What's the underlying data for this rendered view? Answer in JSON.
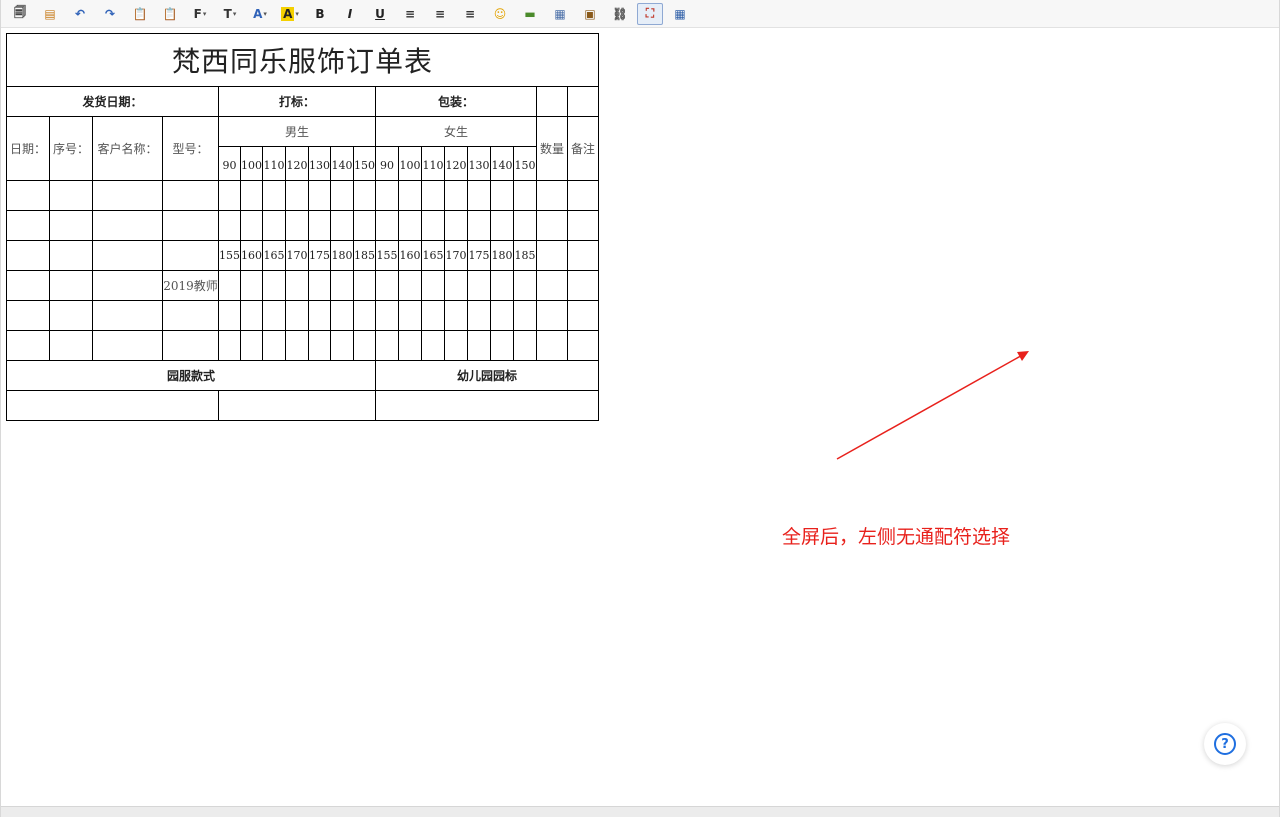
{
  "toolbar": {
    "buttons": [
      {
        "name": "source-button",
        "glyph": "🗐",
        "color": "#444"
      },
      {
        "name": "document-button",
        "glyph": "▤",
        "color": "#c77a18"
      },
      {
        "name": "undo-button",
        "glyph": "↶",
        "color": "#2f62b8"
      },
      {
        "name": "redo-button",
        "glyph": "↷",
        "color": "#2f62b8"
      },
      {
        "name": "paste-button",
        "glyph": "📋",
        "color": "#8a6a2a"
      },
      {
        "name": "paste-text-button",
        "glyph": "📋",
        "color": "#5a74a8"
      },
      {
        "name": "font-family-button",
        "glyph": "F",
        "color": "#333",
        "dropdown": true
      },
      {
        "name": "font-size-button",
        "glyph": "T",
        "color": "#333",
        "dropdown": true
      },
      {
        "name": "font-color-button",
        "glyph": "A",
        "color": "#2f62b8",
        "dropdown": true
      },
      {
        "name": "highlight-color-button",
        "glyph": "A",
        "color": "#222",
        "dropdown": true,
        "bg": "#f4d000"
      },
      {
        "name": "bold-button",
        "glyph": "B",
        "color": "#222"
      },
      {
        "name": "italic-button",
        "glyph": "I",
        "color": "#222"
      },
      {
        "name": "underline-button",
        "glyph": "U",
        "color": "#222"
      },
      {
        "name": "align-left-button",
        "glyph": "≡",
        "color": "#333"
      },
      {
        "name": "align-center-button",
        "glyph": "≡",
        "color": "#333"
      },
      {
        "name": "align-right-button",
        "glyph": "≡",
        "color": "#333"
      },
      {
        "name": "emoticon-button",
        "glyph": "☺",
        "color": "#e3a300"
      },
      {
        "name": "horizontal-rule-button",
        "glyph": "▬",
        "color": "#4a8a2a"
      },
      {
        "name": "insert-table-button",
        "glyph": "▦",
        "color": "#4a6fa8"
      },
      {
        "name": "insert-image-button",
        "glyph": "▣",
        "color": "#8a5a1a"
      },
      {
        "name": "insert-link-button",
        "glyph": "⛓",
        "color": "#555"
      },
      {
        "name": "fullscreen-button",
        "glyph": "⛶",
        "color": "#c0392b",
        "active": true
      },
      {
        "name": "table-properties-button",
        "glyph": "▦",
        "color": "#2f5fa8"
      }
    ]
  },
  "table": {
    "title": "梵西同乐服饰订单表",
    "row2": {
      "ship_date": "发货日期：",
      "marking": "打标：",
      "packing": "包装："
    },
    "headers": {
      "date": "日期：",
      "seq": "序号：",
      "customer": "客户名称：",
      "model": "型号：",
      "male": "男生",
      "female": "女生",
      "qty": "数量",
      "remark": "备注"
    },
    "male_sizes": [
      "90",
      "100",
      "110",
      "120",
      "130",
      "140",
      "150"
    ],
    "female_sizes": [
      "90",
      "100",
      "110",
      "120",
      "130",
      "140",
      "150"
    ],
    "male_sizes_2": [
      "155",
      "160",
      "165",
      "170",
      "175",
      "180",
      "185"
    ],
    "female_sizes_2": [
      "155",
      "160",
      "165",
      "170",
      "175",
      "180",
      "185"
    ],
    "model_note": "2019教师",
    "footer": {
      "style": "园服款式",
      "logo": "幼儿园园标"
    }
  },
  "annotation": {
    "text": "全屏后，左侧无通配符选择",
    "color": "#e8211c"
  },
  "help": {
    "glyph": "?",
    "icon": "question-circle-icon"
  }
}
